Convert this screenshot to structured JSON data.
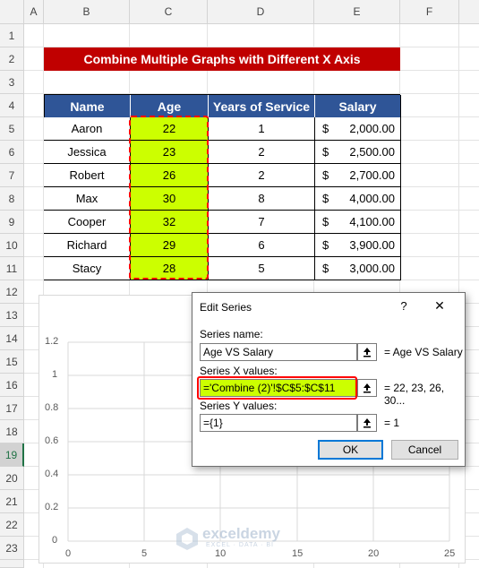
{
  "columns": [
    "A",
    "B",
    "C",
    "D",
    "E",
    "F"
  ],
  "rows": [
    "1",
    "2",
    "3",
    "4",
    "5",
    "6",
    "7",
    "8",
    "9",
    "10",
    "11",
    "12",
    "13",
    "14",
    "15",
    "16",
    "17",
    "18",
    "19",
    "20",
    "21",
    "22",
    "23"
  ],
  "title": "Combine Multiple Graphs with Different X Axis",
  "table": {
    "headers": [
      "Name",
      "Age",
      "Years of Service",
      "Salary"
    ],
    "currency": "$",
    "rows": [
      {
        "name": "Aaron",
        "age": "22",
        "years": "1",
        "salary": "2,000.00"
      },
      {
        "name": "Jessica",
        "age": "23",
        "years": "2",
        "salary": "2,500.00"
      },
      {
        "name": "Robert",
        "age": "26",
        "years": "2",
        "salary": "2,700.00"
      },
      {
        "name": "Max",
        "age": "30",
        "years": "8",
        "salary": "4,000.00"
      },
      {
        "name": "Cooper",
        "age": "32",
        "years": "7",
        "salary": "4,100.00"
      },
      {
        "name": "Richard",
        "age": "29",
        "years": "6",
        "salary": "3,900.00"
      },
      {
        "name": "Stacy",
        "age": "28",
        "years": "5",
        "salary": "3,000.00"
      }
    ]
  },
  "chart": {
    "y_ticks": [
      "1.2",
      "1",
      "0.8",
      "0.6",
      "0.4",
      "0.2",
      "0"
    ],
    "x_ticks": [
      "0",
      "5",
      "10",
      "15",
      "20",
      "25"
    ],
    "watermark": {
      "name": "exceldemy",
      "tagline": "EXCEL · DATA · BI"
    }
  },
  "dialog": {
    "title": "Edit Series",
    "help": "?",
    "close": "✕",
    "series_name_label": "Series name:",
    "series_name_value": "Age VS Salary",
    "series_name_preview": "= Age VS Salary",
    "x_label": "Series X values:",
    "x_value": "='Combine (2)'!$C$5:$C$11",
    "x_preview": "= 22, 23, 26, 30...",
    "y_label": "Series Y values:",
    "y_value": "={1}",
    "y_preview": "= 1",
    "ok": "OK",
    "cancel": "Cancel"
  },
  "colors": {
    "title_bg": "#c00000",
    "header_bg": "#2f5597",
    "age_highlight": "#ccff00",
    "marquee": "#ff0000"
  }
}
